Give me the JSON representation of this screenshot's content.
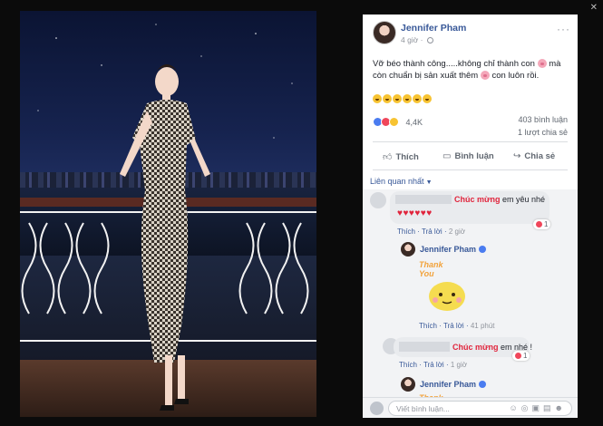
{
  "window": {
    "close_icon": "close-icon"
  },
  "post": {
    "author": "Jennifer Pham",
    "time": "4 giờ",
    "text_line1": "Vỡ béo thành công.....không chỉ thành con",
    "text_line1_after": "mà",
    "text_line2": "còn chuẩn bị sản xuất thêm",
    "text_line2_after": "con luôn rồi.",
    "reactions_count": "4,4K",
    "comments_count": "403 bình luận",
    "shares_count": "1 lượt chia sẻ"
  },
  "actions": {
    "like": "Thích",
    "comment": "Bình luận",
    "share": "Chia sẻ"
  },
  "sort_label": "Liên quan nhất",
  "comments": [
    {
      "highlight": "Chúc mừng",
      "text": " em yêu nhé",
      "hearts": "♥♥♥♥♥♥",
      "react_count": "1",
      "like": "Thích",
      "reply": "Trả lời",
      "time": "2 giờ"
    },
    {
      "reply_author": "Jennifer Pham",
      "sticker_text": "Thank You",
      "like": "Thích",
      "reply": "Trả lời",
      "time": "41 phút"
    },
    {
      "highlight": "Chúc mừng",
      "text": " em nhé !",
      "react_count": "1",
      "like": "Thích",
      "reply": "Trả lời",
      "time": "1 giờ"
    },
    {
      "reply_author": "Jennifer Pham",
      "sticker_text": "Thank"
    }
  ],
  "input": {
    "placeholder": "Viết bình luận..."
  },
  "colors": {
    "facebook_blue": "#385898",
    "love_red": "#e0243c",
    "like_blue": "#4a7cf0"
  }
}
